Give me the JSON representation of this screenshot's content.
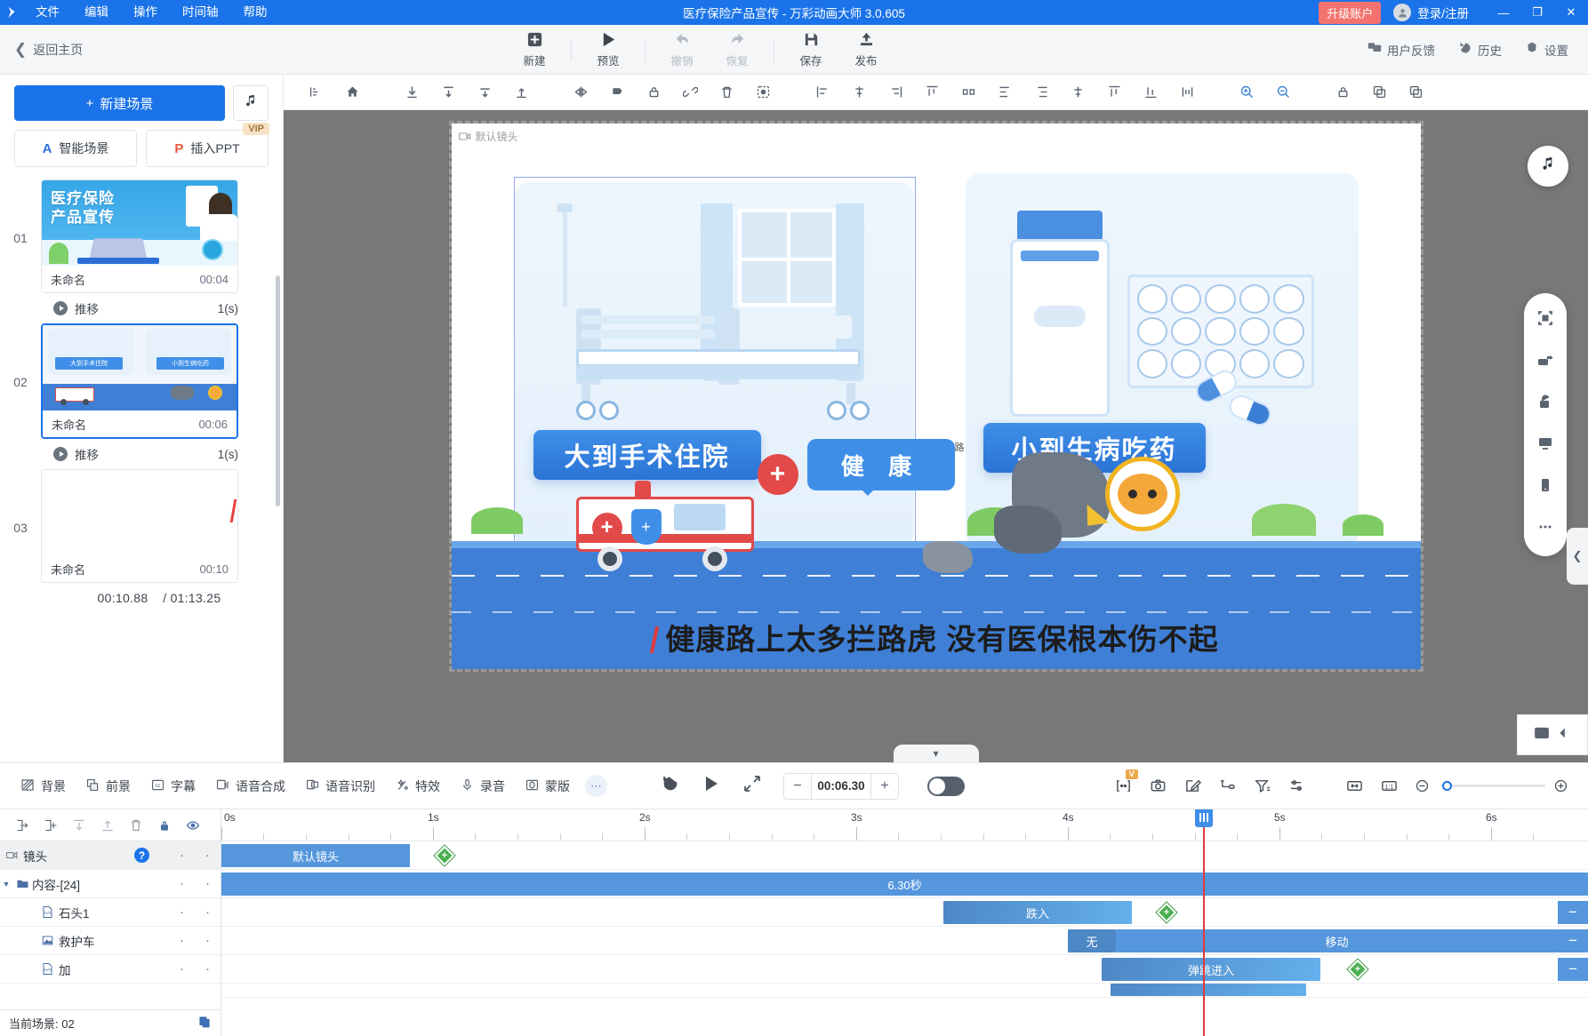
{
  "titlebar": {
    "menus": [
      "文件",
      "编辑",
      "操作",
      "时间轴",
      "帮助"
    ],
    "window_title": "医疗保险产品宣传 - 万彩动画大师 3.0.605",
    "upgrade": "升级账户",
    "login": "登录/注册",
    "minimize": "—",
    "maximize": "❐",
    "close": "✕"
  },
  "toolbar": {
    "back_home": "返回主页",
    "items": [
      {
        "label": "新建",
        "icon": "plus-square-icon",
        "disabled": false
      },
      {
        "label": "预览",
        "icon": "play-icon",
        "disabled": false
      },
      {
        "label": "撤销",
        "icon": "undo-icon",
        "disabled": true
      },
      {
        "label": "恢复",
        "icon": "redo-icon",
        "disabled": true
      },
      {
        "label": "保存",
        "icon": "save-icon",
        "disabled": false
      },
      {
        "label": "发布",
        "icon": "publish-icon",
        "disabled": false
      }
    ],
    "right": [
      {
        "label": "用户反馈",
        "icon": "feedback-icon"
      },
      {
        "label": "历史",
        "icon": "history-icon"
      },
      {
        "label": "设置",
        "icon": "gear-icon"
      }
    ]
  },
  "scenes_panel": {
    "new_scene": "新建场景",
    "new_scene_plus": "+",
    "music_icon": "music-note-icon",
    "smart_scene": "智能场景",
    "insert_ppt": "插入PPT",
    "vip_badge": "VIP",
    "scenes": [
      {
        "num": "01",
        "name": "未命名",
        "duration": "00:04",
        "selected": false
      },
      {
        "num": "02",
        "name": "未命名",
        "duration": "00:06",
        "selected": true
      },
      {
        "num": "03",
        "name": "未命名",
        "duration": "00:10",
        "selected": false
      }
    ],
    "transitions": [
      {
        "label": "推移",
        "value": "1(s)"
      },
      {
        "label": "推移",
        "value": "1(s)"
      }
    ],
    "current_time": "00:10.88",
    "total_time": "/ 01:13.25"
  },
  "canvas": {
    "camera_label": "默认镜头",
    "caption_left": "大到手术住院",
    "caption_right": "小到生病吃药",
    "bubble_text": "健 康",
    "bubble_small": "路",
    "subtitle": "健康路上太多拦路虎 没有医保根本伤不起",
    "collapse_icon": "chevron-down-icon",
    "rail_icons": [
      "fit-screen-icon",
      "flip-icon",
      "unlock-icon",
      "desktop-icon",
      "mobile-icon",
      "more-icon"
    ],
    "rail_music_icon": "music-note-icon",
    "side_collapse_icon": "chevron-left-icon"
  },
  "bottombar": {
    "tools": [
      {
        "label": "背景",
        "icon": "background-icon"
      },
      {
        "label": "前景",
        "icon": "foreground-icon"
      },
      {
        "label": "字幕",
        "icon": "subtitle-icon"
      },
      {
        "label": "语音合成",
        "icon": "tts-icon"
      },
      {
        "label": "语音识别",
        "icon": "asr-icon"
      },
      {
        "label": "特效",
        "icon": "effects-icon"
      },
      {
        "label": "录音",
        "icon": "microphone-icon"
      },
      {
        "label": "蒙版",
        "icon": "mask-icon"
      }
    ],
    "more_icon": "ellipsis-icon",
    "replay_icon": "replay-icon",
    "play_icon": "play-icon",
    "expand_icon": "expand-icon",
    "time_value": "00:06.30",
    "minus": "−",
    "plus": "+",
    "right_tools": [
      {
        "icon": "insert-frame-icon",
        "badge": "V"
      },
      {
        "icon": "camera-icon",
        "badge": ""
      },
      {
        "icon": "edit-icon",
        "badge": ""
      },
      {
        "icon": "keyframe-icon",
        "badge": ""
      },
      {
        "icon": "filter-icon",
        "badge": ""
      },
      {
        "icon": "settings-sliders-icon",
        "badge": ""
      },
      {
        "icon": "fit-width-icon",
        "badge": ""
      },
      {
        "icon": "actual-size-icon",
        "badge": ""
      }
    ],
    "zoom_out_icon": "minus-circle-icon",
    "zoom_in_icon": "plus-circle-icon"
  },
  "timeline": {
    "header_icons": [
      "import-track-icon",
      "add-track-icon",
      "move-down-icon",
      "move-up-icon",
      "delete-icon",
      "lock-icon",
      "eye-icon"
    ],
    "rows": [
      {
        "name": "镜头",
        "icon": "camera-track-icon",
        "selected": true,
        "help": "?"
      },
      {
        "name": "内容-[24]",
        "icon": "folder-icon",
        "selected": false,
        "help": ""
      },
      {
        "name": "石头1",
        "icon": "svg-file-icon",
        "selected": false,
        "help": ""
      },
      {
        "name": "救护车",
        "icon": "image-icon",
        "selected": false,
        "help": ""
      },
      {
        "name": "加",
        "icon": "svg-file-icon",
        "selected": false,
        "help": ""
      }
    ],
    "footer_label": "当前场景: 02",
    "footer_icon": "copy-icon",
    "ruler_labels": [
      "0s",
      "1s",
      "2s",
      "3s",
      "4s",
      "5s",
      "6s"
    ],
    "clips": {
      "camera": "默认镜头",
      "content": "6.30秒",
      "rock_anim": "跌入",
      "ambulance_none": "无",
      "ambulance_move": "移动",
      "plus_anim": "弹跳进入"
    },
    "minus_tab": "−"
  }
}
